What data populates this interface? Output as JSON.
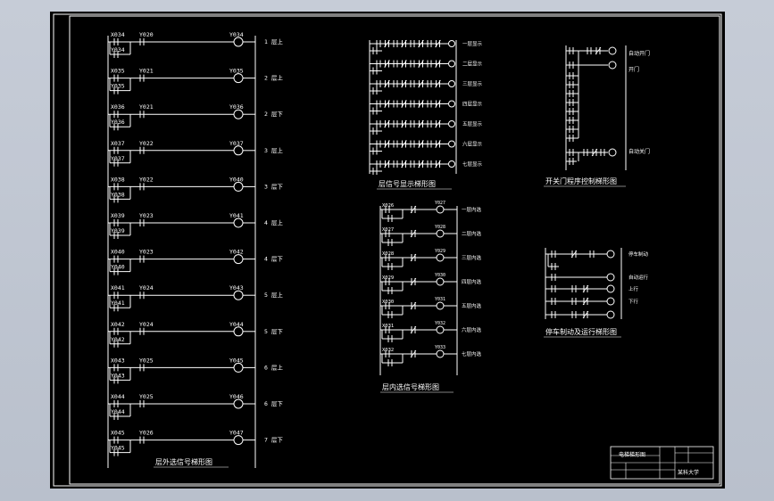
{
  "diagram1": {
    "caption": "层外选信号梯形图",
    "rungs": [
      {
        "in": "X034",
        "hold": "Y034",
        "c": "Y020",
        "out": "Y034",
        "label": "1 层上"
      },
      {
        "in": "X035",
        "hold": "Y035",
        "c": "Y021",
        "out": "Y035",
        "label": "2 层上"
      },
      {
        "in": "X036",
        "hold": "Y036",
        "c": "Y021",
        "out": "Y036",
        "label": "2 层下"
      },
      {
        "in": "X037",
        "hold": "Y037",
        "c": "Y022",
        "out": "Y037",
        "label": "3 层上"
      },
      {
        "in": "X038",
        "hold": "Y038",
        "c": "Y022",
        "out": "Y040",
        "label": "3 层下"
      },
      {
        "in": "X039",
        "hold": "Y039",
        "c": "Y023",
        "out": "Y041",
        "label": "4 层上"
      },
      {
        "in": "X040",
        "hold": "Y040",
        "c": "Y023",
        "out": "Y042",
        "label": "4 层下"
      },
      {
        "in": "X041",
        "hold": "Y041",
        "c": "Y024",
        "out": "Y043",
        "label": "5 层上"
      },
      {
        "in": "X042",
        "hold": "Y042",
        "c": "Y024",
        "out": "Y044",
        "label": "5 层下"
      },
      {
        "in": "X043",
        "hold": "Y043",
        "c": "Y025",
        "out": "Y045",
        "label": "6 层上"
      },
      {
        "in": "X044",
        "hold": "Y044",
        "c": "Y025",
        "out": "Y046",
        "label": "6 层下"
      },
      {
        "in": "X045",
        "hold": "Y045",
        "c": "Y026",
        "out": "Y047",
        "label": "7 层下"
      }
    ]
  },
  "diagram2": {
    "caption": "层信号显示梯形图",
    "outputs": [
      "一层显示",
      "二层显示",
      "三层显示",
      "四层显示",
      "五层显示",
      "六层显示",
      "七层显示"
    ]
  },
  "diagram3": {
    "caption": "层内选信号梯形图",
    "rows": [
      {
        "in": "X026",
        "out": "Y027",
        "label": "一层内选"
      },
      {
        "in": "X027",
        "out": "Y028",
        "label": "二层内选"
      },
      {
        "in": "X028",
        "out": "Y029",
        "label": "三层内选"
      },
      {
        "in": "X029",
        "out": "Y030",
        "label": "四层内选"
      },
      {
        "in": "X030",
        "out": "Y031",
        "label": "五层内选"
      },
      {
        "in": "X031",
        "out": "Y032",
        "label": "六层内选"
      },
      {
        "in": "X032",
        "out": "Y033",
        "label": "七层内选"
      }
    ]
  },
  "diagram4": {
    "caption": "开关门程序控制梯形图",
    "label_top": "自动开门",
    "label_top2": "开门",
    "label_bottom": "自动关门"
  },
  "diagram5": {
    "caption": "停车制动及运行梯形图",
    "labels": [
      "停车制动",
      "自动运行",
      "上行",
      "下行"
    ]
  },
  "titleblock": {
    "drawing_name": "电梯梯形图",
    "school": "某科大学"
  }
}
